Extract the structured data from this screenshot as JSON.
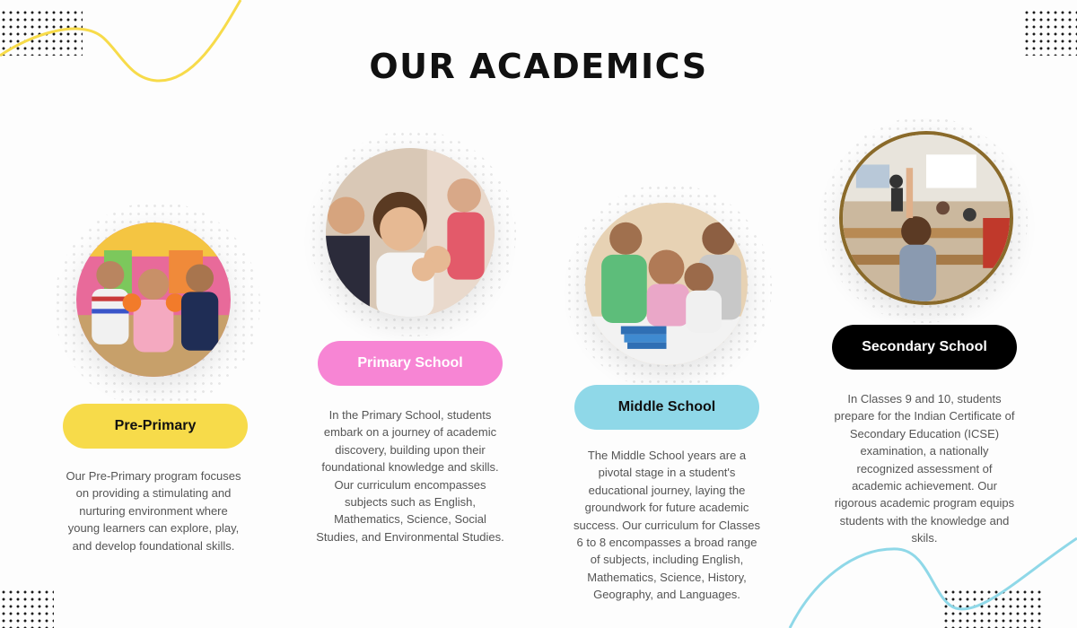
{
  "page": {
    "title": "OUR ACADEMICS",
    "colors": {
      "yellow": "#f7db4a",
      "pink": "#f785d4",
      "blue": "#8fd8e8",
      "black": "#000000",
      "gold_ring": "#8a6a2a"
    }
  },
  "programs": [
    {
      "label": "Pre-Primary",
      "description": "Our Pre-Primary program focuses on providing a stimulating and nurturing environment where young learners can explore, play, and develop foundational skills."
    },
    {
      "label": "Primary School",
      "description": "In the Primary School, students embark on a journey of academic discovery, building upon their foundational knowledge and skills. Our curriculum encompasses subjects such as English, Mathematics, Science, Social Studies, and Environmental Studies."
    },
    {
      "label": "Middle School",
      "description": "The Middle School years are a pivotal stage in a student's educational journey, laying the groundwork for future academic success. Our curriculum for Classes 6 to 8 encompasses a broad range of subjects, including English, Mathematics, Science, History, Geography, and Languages."
    },
    {
      "label": "Secondary School",
      "description": "In Classes 9 and 10, students prepare for the Indian Certificate of Secondary Education (ICSE) examination, a nationally recognized assessment of academic achievement. Our rigorous academic program equips students with the knowledge and skils."
    }
  ]
}
